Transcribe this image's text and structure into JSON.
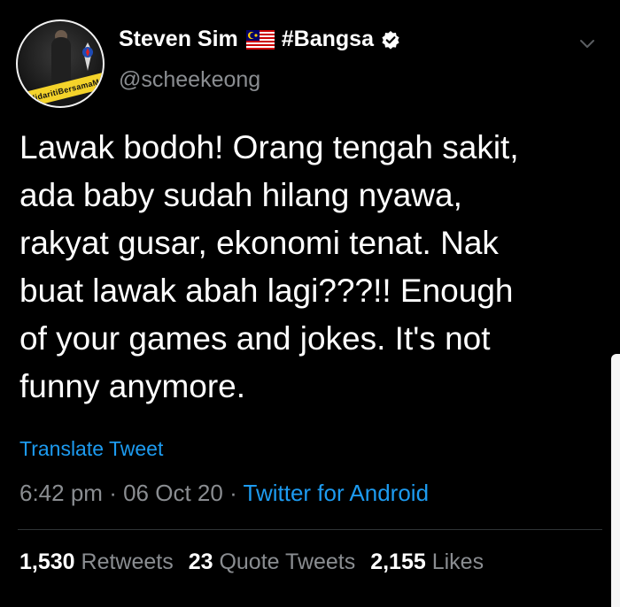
{
  "tweet": {
    "author": {
      "display_name": "Steven Sim",
      "flag_icon": "malaysia-flag-icon",
      "name_suffix": "#Bangsa",
      "verified_icon": "verified-badge-icon",
      "handle": "@scheekeong",
      "avatar_banner_text": "#SolidaritiBersamaMu"
    },
    "text": "Lawak bodoh! Orang tengah sakit,\nada baby sudah hilang nyawa,\nrakyat gusar, ekonomi tenat. Nak\nbuat lawak abah lagi???!! Enough\nof your games and jokes. It's not\nfunny anymore.",
    "translate_label": "Translate Tweet",
    "time": "6:42 pm",
    "separator": "·",
    "date": "06 Oct 20",
    "source": "Twitter for Android",
    "stats": {
      "retweets_count": "1,530",
      "retweets_label": "Retweets",
      "quotes_count": "23",
      "quotes_label": "Quote Tweets",
      "likes_count": "2,155",
      "likes_label": "Likes"
    }
  },
  "colors": {
    "background": "#000000",
    "text": "#ffffff",
    "muted": "#8a8d91",
    "link": "#1d9bf0"
  }
}
